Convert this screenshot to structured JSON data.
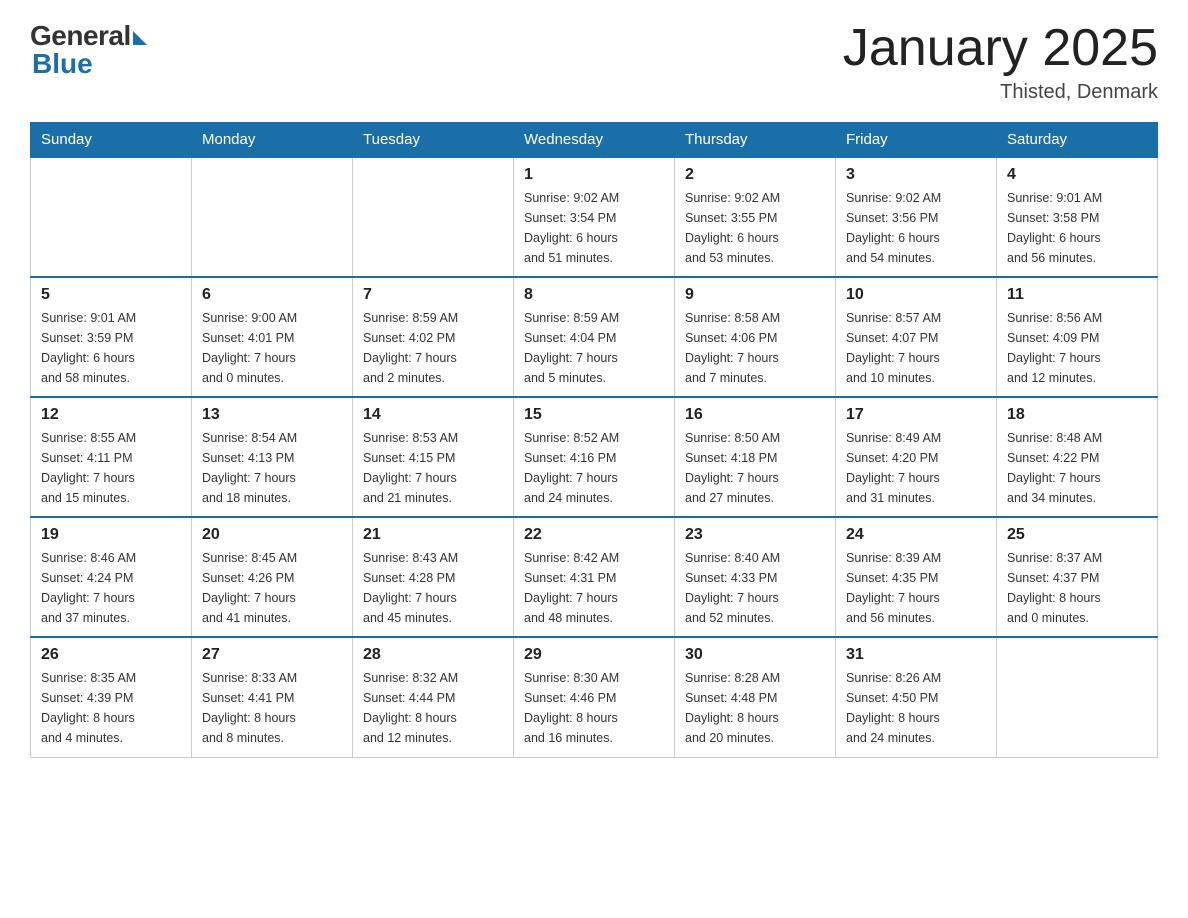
{
  "logo": {
    "general": "General",
    "blue": "Blue"
  },
  "title": "January 2025",
  "subtitle": "Thisted, Denmark",
  "days_of_week": [
    "Sunday",
    "Monday",
    "Tuesday",
    "Wednesday",
    "Thursday",
    "Friday",
    "Saturday"
  ],
  "weeks": [
    [
      {
        "num": "",
        "info": ""
      },
      {
        "num": "",
        "info": ""
      },
      {
        "num": "",
        "info": ""
      },
      {
        "num": "1",
        "info": "Sunrise: 9:02 AM\nSunset: 3:54 PM\nDaylight: 6 hours\nand 51 minutes."
      },
      {
        "num": "2",
        "info": "Sunrise: 9:02 AM\nSunset: 3:55 PM\nDaylight: 6 hours\nand 53 minutes."
      },
      {
        "num": "3",
        "info": "Sunrise: 9:02 AM\nSunset: 3:56 PM\nDaylight: 6 hours\nand 54 minutes."
      },
      {
        "num": "4",
        "info": "Sunrise: 9:01 AM\nSunset: 3:58 PM\nDaylight: 6 hours\nand 56 minutes."
      }
    ],
    [
      {
        "num": "5",
        "info": "Sunrise: 9:01 AM\nSunset: 3:59 PM\nDaylight: 6 hours\nand 58 minutes."
      },
      {
        "num": "6",
        "info": "Sunrise: 9:00 AM\nSunset: 4:01 PM\nDaylight: 7 hours\nand 0 minutes."
      },
      {
        "num": "7",
        "info": "Sunrise: 8:59 AM\nSunset: 4:02 PM\nDaylight: 7 hours\nand 2 minutes."
      },
      {
        "num": "8",
        "info": "Sunrise: 8:59 AM\nSunset: 4:04 PM\nDaylight: 7 hours\nand 5 minutes."
      },
      {
        "num": "9",
        "info": "Sunrise: 8:58 AM\nSunset: 4:06 PM\nDaylight: 7 hours\nand 7 minutes."
      },
      {
        "num": "10",
        "info": "Sunrise: 8:57 AM\nSunset: 4:07 PM\nDaylight: 7 hours\nand 10 minutes."
      },
      {
        "num": "11",
        "info": "Sunrise: 8:56 AM\nSunset: 4:09 PM\nDaylight: 7 hours\nand 12 minutes."
      }
    ],
    [
      {
        "num": "12",
        "info": "Sunrise: 8:55 AM\nSunset: 4:11 PM\nDaylight: 7 hours\nand 15 minutes."
      },
      {
        "num": "13",
        "info": "Sunrise: 8:54 AM\nSunset: 4:13 PM\nDaylight: 7 hours\nand 18 minutes."
      },
      {
        "num": "14",
        "info": "Sunrise: 8:53 AM\nSunset: 4:15 PM\nDaylight: 7 hours\nand 21 minutes."
      },
      {
        "num": "15",
        "info": "Sunrise: 8:52 AM\nSunset: 4:16 PM\nDaylight: 7 hours\nand 24 minutes."
      },
      {
        "num": "16",
        "info": "Sunrise: 8:50 AM\nSunset: 4:18 PM\nDaylight: 7 hours\nand 27 minutes."
      },
      {
        "num": "17",
        "info": "Sunrise: 8:49 AM\nSunset: 4:20 PM\nDaylight: 7 hours\nand 31 minutes."
      },
      {
        "num": "18",
        "info": "Sunrise: 8:48 AM\nSunset: 4:22 PM\nDaylight: 7 hours\nand 34 minutes."
      }
    ],
    [
      {
        "num": "19",
        "info": "Sunrise: 8:46 AM\nSunset: 4:24 PM\nDaylight: 7 hours\nand 37 minutes."
      },
      {
        "num": "20",
        "info": "Sunrise: 8:45 AM\nSunset: 4:26 PM\nDaylight: 7 hours\nand 41 minutes."
      },
      {
        "num": "21",
        "info": "Sunrise: 8:43 AM\nSunset: 4:28 PM\nDaylight: 7 hours\nand 45 minutes."
      },
      {
        "num": "22",
        "info": "Sunrise: 8:42 AM\nSunset: 4:31 PM\nDaylight: 7 hours\nand 48 minutes."
      },
      {
        "num": "23",
        "info": "Sunrise: 8:40 AM\nSunset: 4:33 PM\nDaylight: 7 hours\nand 52 minutes."
      },
      {
        "num": "24",
        "info": "Sunrise: 8:39 AM\nSunset: 4:35 PM\nDaylight: 7 hours\nand 56 minutes."
      },
      {
        "num": "25",
        "info": "Sunrise: 8:37 AM\nSunset: 4:37 PM\nDaylight: 8 hours\nand 0 minutes."
      }
    ],
    [
      {
        "num": "26",
        "info": "Sunrise: 8:35 AM\nSunset: 4:39 PM\nDaylight: 8 hours\nand 4 minutes."
      },
      {
        "num": "27",
        "info": "Sunrise: 8:33 AM\nSunset: 4:41 PM\nDaylight: 8 hours\nand 8 minutes."
      },
      {
        "num": "28",
        "info": "Sunrise: 8:32 AM\nSunset: 4:44 PM\nDaylight: 8 hours\nand 12 minutes."
      },
      {
        "num": "29",
        "info": "Sunrise: 8:30 AM\nSunset: 4:46 PM\nDaylight: 8 hours\nand 16 minutes."
      },
      {
        "num": "30",
        "info": "Sunrise: 8:28 AM\nSunset: 4:48 PM\nDaylight: 8 hours\nand 20 minutes."
      },
      {
        "num": "31",
        "info": "Sunrise: 8:26 AM\nSunset: 4:50 PM\nDaylight: 8 hours\nand 24 minutes."
      },
      {
        "num": "",
        "info": ""
      }
    ]
  ]
}
